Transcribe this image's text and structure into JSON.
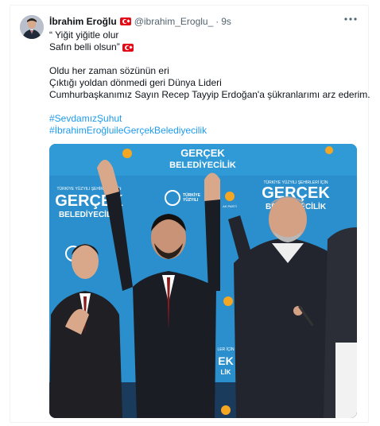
{
  "tweet": {
    "author_name": "İbrahim Eroğlu",
    "handle": "@ibrahim_Eroglu_",
    "separator": "·",
    "time": "9s",
    "more_icon": "more-horizontal-icon",
    "lines": {
      "quote_line1": "“ Yiğit yiğitle olur",
      "quote_line2": "Safın belli olsun”",
      "body_line1": "Oldu her zaman sözünün eri",
      "body_line2": "Çıktığı yoldan dönmedi geri Dünya Lideri",
      "body_line3": "Cumhurbaşkanımız Sayın Recep Tayyip Erdoğan'a şükranlarımı arz ederim."
    },
    "hashtags": [
      "#SevdamızŞuhut",
      "#İbrahimEroğluileGerçekBelediyecilik"
    ]
  },
  "media": {
    "banner_texts": {
      "top_center": "GERÇEK\nBELEDİYECİLİK",
      "left_big": "GERÇEK",
      "left_big_sub": "BELEDİYECİLİK",
      "right_heading": "TÜRKİYE YÜZYILI ŞEHİRLERİ İÇİN",
      "right_big": "GERÇEK",
      "right_big_sub": "BELEDİYECİLİK",
      "left_heading": "TÜRKİYE YÜZYILI ŞEHİRLERİ İÇİN",
      "party": "AK PARTİ",
      "yuzyil": "TÜRKİYE YÜZYILI",
      "bottom_right": "LER İÇİN",
      "bottom_right_big": "EK",
      "bottom_right_sub": "LİK"
    },
    "colors": {
      "banner_blue": "#2a8fcc",
      "banner_text": "#ffffff",
      "accent_orange": "#f5a623"
    }
  }
}
